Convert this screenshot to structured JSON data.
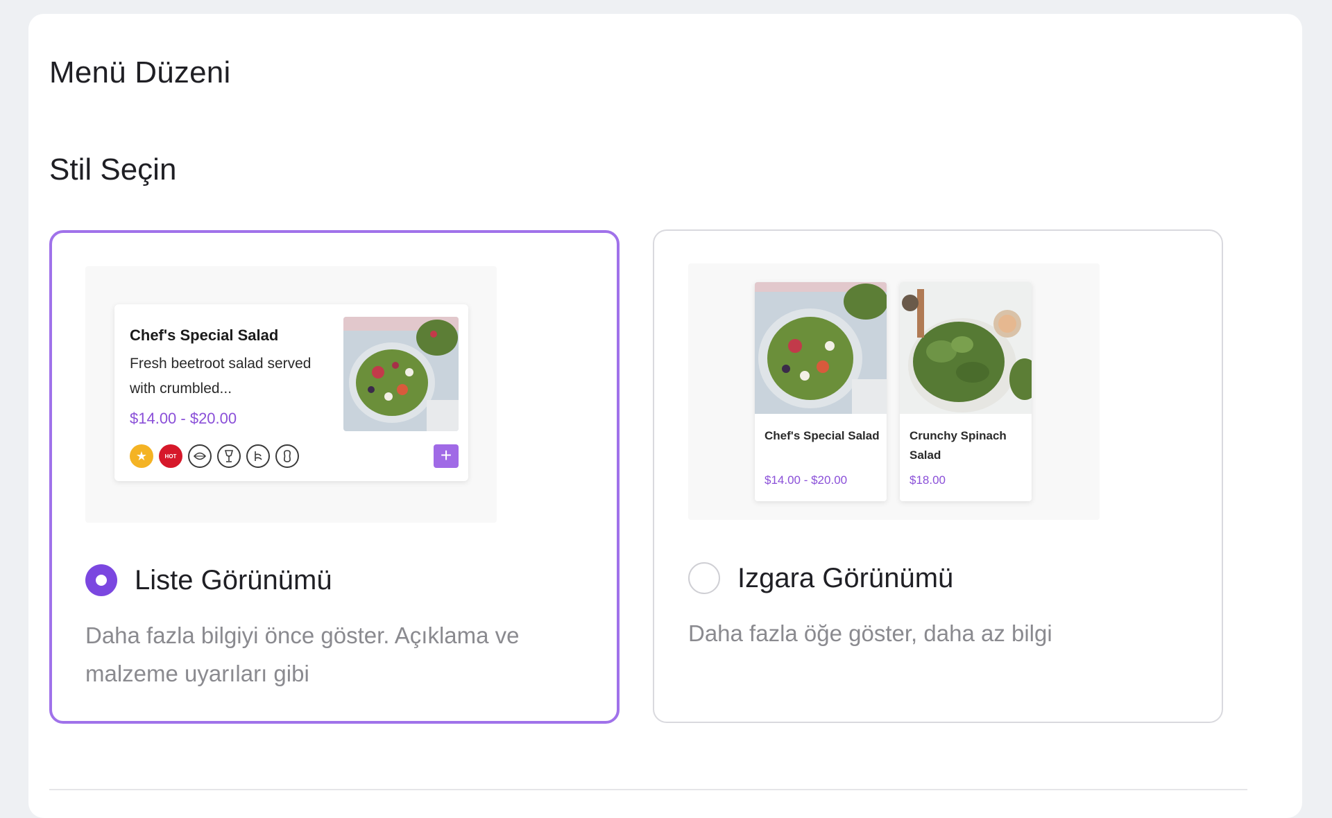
{
  "page": {
    "title": "Menü Düzeni",
    "section_title": "Stil Seçin"
  },
  "options": [
    {
      "label": "Liste Görünümü",
      "description": "Daha fazla bilgiyi önce göster. Açıklama ve malzeme uyarıları gibi",
      "selected": true
    },
    {
      "label": "Izgara Görünümü",
      "description": "Daha fazla öğe göster, daha az bilgi",
      "selected": false
    }
  ],
  "list_preview": {
    "item_name": "Chef's Special Salad",
    "item_description": "Fresh beetroot salad served with crumbled...",
    "item_price": "$14.00 - $20.00",
    "hot_badge": "HOT",
    "add_label": "+",
    "badges": [
      "star-icon",
      "hot-badge",
      "vegan-icon",
      "alcohol-icon",
      "gluten-icon",
      "peanut-icon"
    ]
  },
  "grid_preview": {
    "items": [
      {
        "name": "Chef's Special Salad",
        "price": "$14.00 - $20.00"
      },
      {
        "name": "Crunchy Spinach Salad",
        "price": "$18.00"
      }
    ]
  },
  "colors": {
    "accent": "#7b47e0",
    "selected_border": "#a072ea",
    "price": "#8a4fd8",
    "muted_text": "#8a8a8f"
  }
}
